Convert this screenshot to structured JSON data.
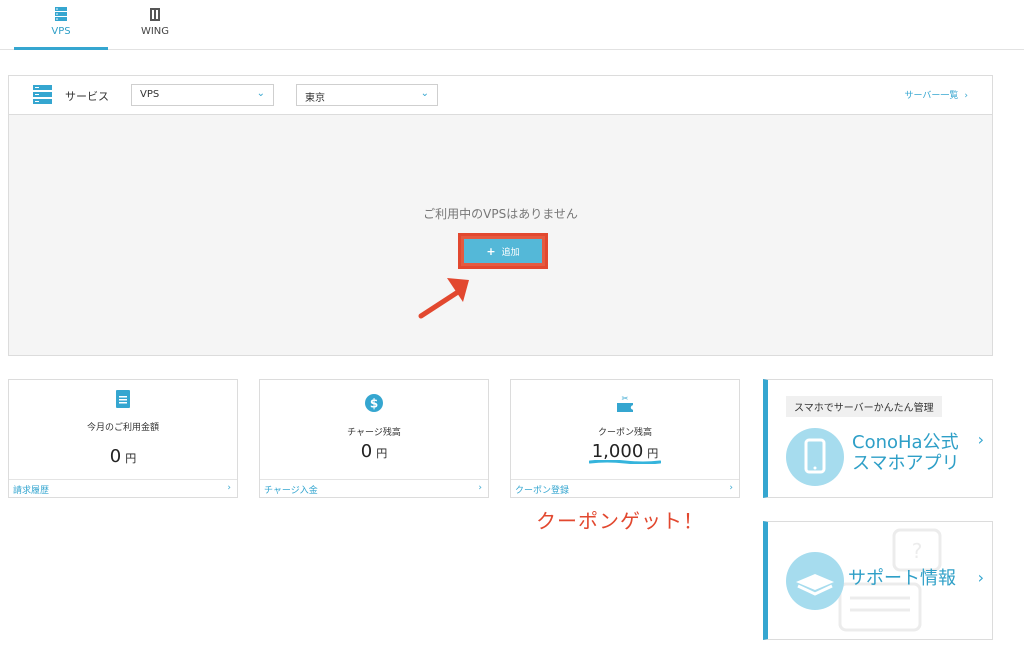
{
  "tabs": [
    {
      "label": "VPS",
      "icon": "server-icon",
      "active": true
    },
    {
      "label": "WING",
      "icon": "building-icon",
      "active": false
    }
  ],
  "services": {
    "label": "サービス",
    "service_select": "VPS",
    "region_select": "東京",
    "server_list_link": "サーバー一覧",
    "empty_message": "ご利用中のVPSはありません",
    "add_button": "追加"
  },
  "cards": [
    {
      "title": "今月のご利用金額",
      "value": "0",
      "unit": "円",
      "footer": "請求履歴",
      "icon": "document-icon"
    },
    {
      "title": "チャージ残高",
      "value": "0",
      "unit": "円",
      "footer": "チャージ入金",
      "icon": "dollar-icon"
    },
    {
      "title": "クーポン残高",
      "value": "1,000",
      "unit": "円",
      "footer": "クーポン登録",
      "icon": "coupon-icon"
    }
  ],
  "promo_app": {
    "tag": "スマホでサーバーかんたん管理",
    "line1": "ConoHa公式",
    "line2": "スマホアプリ"
  },
  "promo_support": {
    "text": "サポート情報"
  },
  "annotation": "クーポンゲット！",
  "colors": {
    "accent": "#35a6d0",
    "annotation_red": "#e2482f"
  }
}
